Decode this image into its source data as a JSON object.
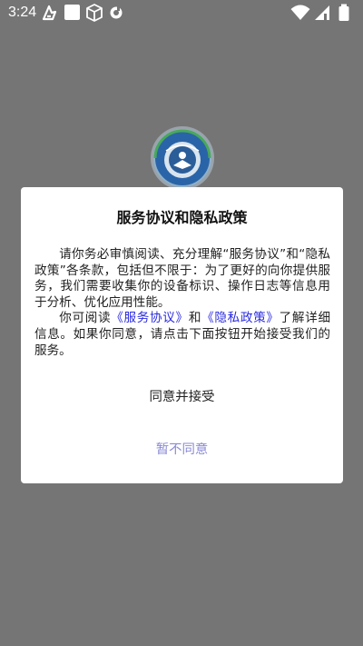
{
  "status_bar": {
    "time": "3:24",
    "icons": [
      "accessibility-icon",
      "notification-square-icon",
      "package-icon",
      "media-icon",
      "wifi-icon",
      "signal-icon",
      "battery-icon"
    ]
  },
  "splash": {
    "logo_icon": "school-badge-logo"
  },
  "dialog": {
    "title": "服务协议和隐私政策",
    "paragraph1": "请你务必审慎阅读、充分理解“服务协议”和“隐私政策”各条款，包括但不限于：为了更好的向你提供服务，我们需要收集你的设备标识、操作日志等信息用于分析、优化应用性能。",
    "paragraph2_prefix": "你可阅读",
    "service_link": "《服务协议》",
    "paragraph2_and": "和",
    "privacy_link": "《隐私政策》",
    "paragraph2_suffix": "了解详细信息。如果你同意，请点击下面按钮开始接受我们的服务。",
    "agree_label": "同意并接受",
    "disagree_label": "暂不同意"
  },
  "colors": {
    "overlay": "#757575",
    "dialog_bg": "#ffffff",
    "link": "#2a2adf",
    "disagree": "#8a8ad6",
    "logo_blue": "#1f6fb2",
    "logo_green": "#3aa84a"
  }
}
